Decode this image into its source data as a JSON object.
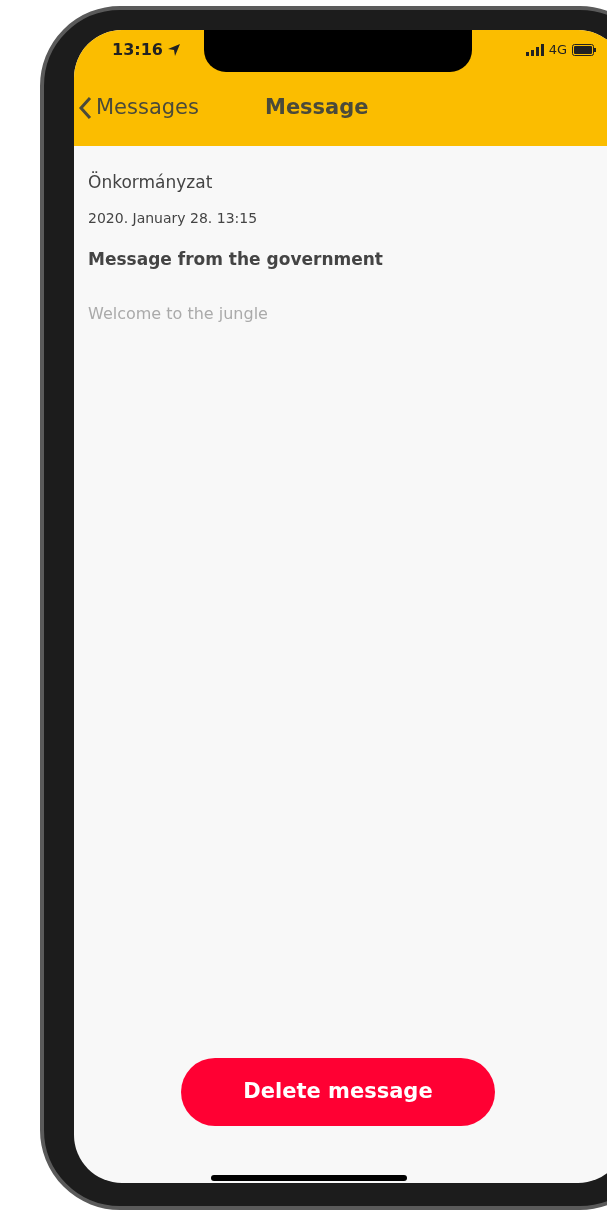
{
  "status_bar": {
    "time": "13:16",
    "network": "4G"
  },
  "nav_bar": {
    "back_label": "Messages",
    "title": "Message"
  },
  "message": {
    "sender": "Önkormányzat",
    "date": "2020. January 28. 13:15",
    "subject": "Message from the government",
    "body": "Welcome to the jungle"
  },
  "delete_button": {
    "label": "Delete message"
  }
}
